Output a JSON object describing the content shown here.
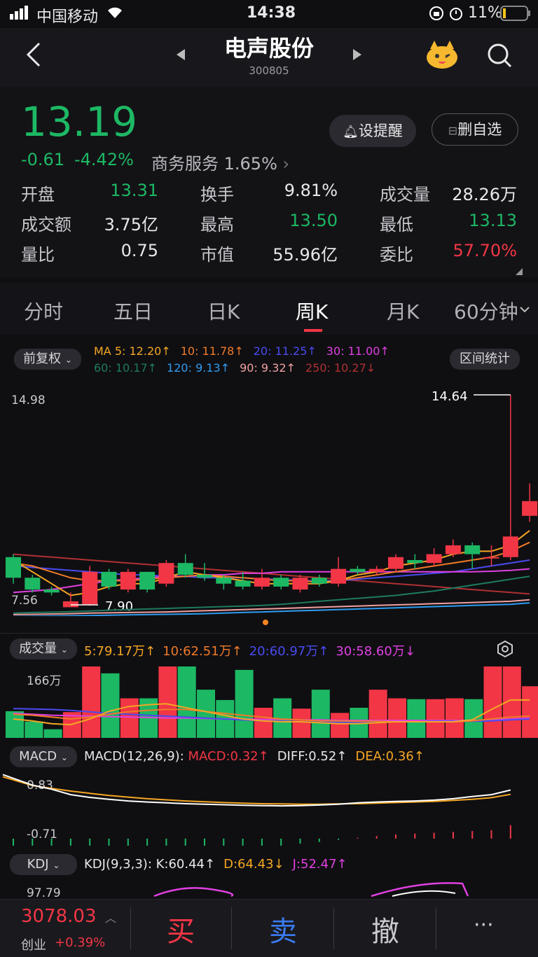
{
  "status": {
    "carrier": "中国移动",
    "time": "14:38",
    "battery": "11%"
  },
  "header": {
    "title": "电声股份",
    "code": "300805",
    "prev_icon": "triangle-left-icon",
    "next_icon": "triangle-right-icon"
  },
  "quote": {
    "price": "13.19",
    "change": "-0.61",
    "pct": "-4.42%",
    "sector": "商务服务",
    "sector_pct": "1.65%",
    "alert_btn": "设提醒",
    "remove_btn": "删自选",
    "stats": [
      {
        "label": "开盘",
        "value": "13.31",
        "color": "#1db864"
      },
      {
        "label": "换手",
        "value": "9.81%",
        "color": "#e8e8ea"
      },
      {
        "label": "成交量",
        "value": "28.26万",
        "color": "#e8e8ea"
      },
      {
        "label": "成交额",
        "value": "3.75亿",
        "color": "#e8e8ea"
      },
      {
        "label": "最高",
        "value": "13.50",
        "color": "#1db864"
      },
      {
        "label": "最低",
        "value": "13.13",
        "color": "#1db864"
      },
      {
        "label": "量比",
        "value": "0.75",
        "color": "#e8e8ea"
      },
      {
        "label": "市值",
        "value": "55.96亿",
        "color": "#e8e8ea"
      },
      {
        "label": "委比",
        "value": "57.70%",
        "color": "#f23645"
      }
    ]
  },
  "tabs": [
    "分时",
    "五日",
    "日K",
    "周K",
    "月K",
    "60分钟"
  ],
  "active_tab": 3,
  "kline": {
    "adj_btn": "前复权",
    "stats_btn": "区间统计",
    "ma1": [
      {
        "text": "MA 5: 12.20↑",
        "color": "#f5a623"
      },
      {
        "text": "10: 11.78↑",
        "color": "#f07a28"
      },
      {
        "text": "20: 11.25↑",
        "color": "#4a4af0"
      },
      {
        "text": "30: 11.00↑",
        "color": "#e040e0"
      }
    ],
    "ma2": [
      {
        "text": "60: 10.17↑",
        "color": "#1f7a5e"
      },
      {
        "text": "120: 9.13↑",
        "color": "#2f9cf0"
      },
      {
        "text": "90: 9.32↑",
        "color": "#f0a0a0"
      },
      {
        "text": "250: 10.27↓",
        "color": "#b03030"
      }
    ],
    "axis_top": "14.98",
    "axis_bottom": "7.56",
    "high_label": "14.64",
    "low_label": "7.90"
  },
  "volume": {
    "label": "成交量",
    "axis_top": "166万",
    "axis_zero": "0",
    "mas": [
      {
        "text": "5:79.17万↑",
        "color": "#f5a623"
      },
      {
        "text": "10:62.51万↑",
        "color": "#f07a28"
      },
      {
        "text": "20:60.97万↑",
        "color": "#4a4af0"
      },
      {
        "text": "30:58.60万↓",
        "color": "#e040e0"
      }
    ]
  },
  "macd": {
    "label": "MACD",
    "params": "MACD(12,26,9):",
    "axis_top": "0.83",
    "axis_bottom": "-0.71",
    "vals": [
      {
        "text": "MACD:0.32↑",
        "color": "#f23645"
      },
      {
        "text": "DIFF:0.52↑",
        "color": "#e8e8ea"
      },
      {
        "text": "DEA:0.36↑",
        "color": "#f5a623"
      }
    ]
  },
  "kdj": {
    "label": "KDJ",
    "params": "KDJ(9,3,3):",
    "axis_top": "97.79",
    "vals": [
      {
        "text": "K:60.44↑",
        "color": "#e8e8ea"
      },
      {
        "text": "D:64.43↓",
        "color": "#f5a623"
      },
      {
        "text": "J:52.47↑",
        "color": "#e040e0"
      }
    ]
  },
  "bottom": {
    "index_value": "3078.03",
    "index_name": "创业",
    "index_pct": "+0.39%",
    "buy": "买",
    "sell": "卖",
    "cancel": "撤",
    "more": "···"
  },
  "chart_data": {
    "type": "candlestick",
    "candles": [
      {
        "o": 9.5,
        "c": 8.8,
        "h": 9.6,
        "l": 8.6
      },
      {
        "o": 8.8,
        "c": 8.4,
        "h": 8.9,
        "l": 8.3
      },
      {
        "o": 8.4,
        "c": 8.3,
        "h": 8.5,
        "l": 8.2
      },
      {
        "o": 7.8,
        "c": 8.0,
        "h": 8.3,
        "l": 7.9
      },
      {
        "o": 7.9,
        "c": 9.0,
        "h": 9.2,
        "l": 7.85
      },
      {
        "o": 9.0,
        "c": 8.5,
        "h": 9.1,
        "l": 8.4
      },
      {
        "o": 8.4,
        "c": 9.0,
        "h": 9.1,
        "l": 8.3
      },
      {
        "o": 9.0,
        "c": 8.4,
        "h": 9.0,
        "l": 8.3
      },
      {
        "o": 8.6,
        "c": 9.3,
        "h": 9.4,
        "l": 8.5
      },
      {
        "o": 9.3,
        "c": 8.9,
        "h": 9.6,
        "l": 8.8
      },
      {
        "o": 8.9,
        "c": 8.8,
        "h": 9.3,
        "l": 8.7
      },
      {
        "o": 8.8,
        "c": 8.6,
        "h": 8.9,
        "l": 8.4
      },
      {
        "o": 8.7,
        "c": 8.5,
        "h": 9.0,
        "l": 8.4
      },
      {
        "o": 8.5,
        "c": 8.8,
        "h": 9.1,
        "l": 8.4
      },
      {
        "o": 8.8,
        "c": 8.5,
        "h": 8.9,
        "l": 8.4
      },
      {
        "o": 8.4,
        "c": 8.8,
        "h": 8.9,
        "l": 8.3
      },
      {
        "o": 8.8,
        "c": 8.6,
        "h": 8.9,
        "l": 8.5
      },
      {
        "o": 8.6,
        "c": 9.1,
        "h": 9.5,
        "l": 8.5
      },
      {
        "o": 9.1,
        "c": 9.0,
        "h": 9.2,
        "l": 8.9
      },
      {
        "o": 9.0,
        "c": 9.1,
        "h": 9.2,
        "l": 8.9
      },
      {
        "o": 9.1,
        "c": 9.5,
        "h": 9.6,
        "l": 9.0
      },
      {
        "o": 9.4,
        "c": 9.3,
        "h": 9.6,
        "l": 9.1
      },
      {
        "o": 9.3,
        "c": 9.6,
        "h": 9.8,
        "l": 9.2
      },
      {
        "o": 9.6,
        "c": 9.9,
        "h": 10.1,
        "l": 9.5
      },
      {
        "o": 9.9,
        "c": 9.6,
        "h": 10.0,
        "l": 9.1
      },
      {
        "o": 9.5,
        "c": 9.5,
        "h": 9.9,
        "l": 9.2
      },
      {
        "o": 9.5,
        "c": 10.2,
        "h": 14.64,
        "l": 9.4
      },
      {
        "o": 10.9,
        "c": 11.4,
        "h": 12.0,
        "l": 10.7
      }
    ],
    "volume": [
      62,
      38,
      20,
      60,
      166,
      150,
      92,
      92,
      170,
      178,
      112,
      88,
      158,
      70,
      92,
      68,
      112,
      58,
      70,
      112,
      92,
      90,
      90,
      92,
      90,
      178,
      166,
      120
    ],
    "macd_hist": [
      -0.5,
      -0.6,
      -0.7,
      -0.7,
      -0.6,
      -0.55,
      -0.5,
      -0.45,
      -0.4,
      -0.35,
      -0.3,
      -0.28,
      -0.25,
      -0.2,
      -0.18,
      -0.12,
      -0.08,
      -0.03,
      0.02,
      0.06,
      0.1,
      0.12,
      0.14,
      0.16,
      0.18,
      0.2,
      0.32
    ],
    "diff": [
      0.83,
      0.7,
      0.55,
      0.35,
      0.25,
      0.18,
      0.12,
      0.08,
      0.05,
      0.02,
      0.0,
      -0.02,
      -0.04,
      -0.05,
      -0.06,
      -0.05,
      -0.03,
      0.0,
      0.05,
      0.08,
      0.1,
      0.12,
      0.15,
      0.2,
      0.28,
      0.35,
      0.52
    ],
    "dea": [
      0.75,
      0.68,
      0.58,
      0.48,
      0.4,
      0.32,
      0.26,
      0.2,
      0.16,
      0.12,
      0.09,
      0.06,
      0.04,
      0.02,
      0.01,
      0.0,
      0.0,
      0.01,
      0.02,
      0.04,
      0.06,
      0.08,
      0.1,
      0.14,
      0.18,
      0.24,
      0.36
    ]
  }
}
